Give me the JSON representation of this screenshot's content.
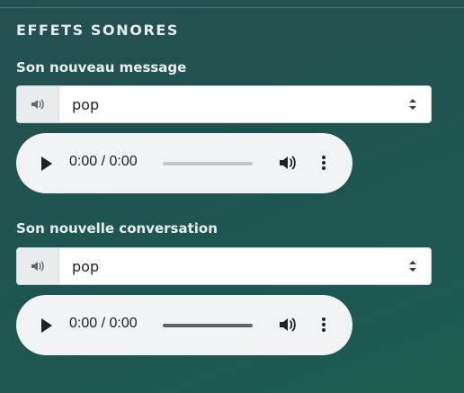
{
  "section": {
    "title": "EFFETS SONORES"
  },
  "fields": [
    {
      "label": "Son nouveau message",
      "select": {
        "value": "pop",
        "icon": "speaker-icon",
        "caret_icon": "select-caret-icon"
      },
      "player": {
        "time": "0:00 / 0:00",
        "progress": 0.0,
        "track_style": "light"
      }
    },
    {
      "label": "Son nouvelle conversation",
      "select": {
        "value": "pop",
        "icon": "speaker-icon",
        "caret_icon": "select-caret-icon"
      },
      "player": {
        "time": "0:00 / 0:00",
        "progress": 0.0,
        "track_style": "dark"
      }
    }
  ],
  "colors": {
    "background_start": "#244f50",
    "background_end": "#1b5d4f",
    "player_bg": "#f1f3f4",
    "addon_bg": "#e9ecef"
  }
}
